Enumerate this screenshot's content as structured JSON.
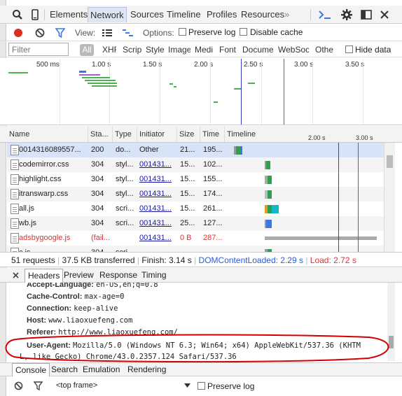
{
  "toolbar": {
    "tabs": [
      "Elements",
      "Network",
      "Sources",
      "Timeline",
      "Profiles",
      "Resources"
    ],
    "active_tab": "Network",
    "more_glyph": "»"
  },
  "controls": {
    "view_label": "View:",
    "options_label": "Options:",
    "preserve_log": "Preserve log",
    "disable_cache": "Disable cache"
  },
  "filter": {
    "placeholder": "Filter",
    "types": [
      "All",
      "XHR",
      "Scripts",
      "Stylesheets",
      "Images",
      "Media",
      "Font",
      "Document",
      "WebSockets",
      "Other"
    ],
    "visible_types": [
      "All",
      "XHF",
      "Scrip",
      "Style",
      "Image",
      "Medi",
      "Font",
      "Docume",
      "WebSoc",
      "Othe"
    ],
    "hide_data": "Hide data"
  },
  "overview": {
    "ticks": [
      "500 ms",
      "1.00 s",
      "1.50 s",
      "2.00 s",
      "2.50 s",
      "3.00 s",
      "3.50 s"
    ]
  },
  "table": {
    "columns": [
      "Name",
      "Sta...",
      "Type",
      "Initiator",
      "Size",
      "Time",
      "Timeline"
    ],
    "timeline_ticks": [
      "2.00 s",
      "3.00 s"
    ],
    "rows": [
      {
        "name": "0014316089557...",
        "status": "200",
        "type": "do...",
        "initiator": "Other",
        "size": "21...",
        "time": "195...",
        "selected": true,
        "error": false
      },
      {
        "name": "codemirror.css",
        "status": "304",
        "type": "styl...",
        "initiator": "001431...",
        "size": "15...",
        "time": "102...",
        "selected": false,
        "error": false
      },
      {
        "name": "highlight.css",
        "status": "304",
        "type": "styl...",
        "initiator": "001431...",
        "size": "15...",
        "time": "155...",
        "selected": false,
        "error": false
      },
      {
        "name": "itranswarp.css",
        "status": "304",
        "type": "styl...",
        "initiator": "001431...",
        "size": "15...",
        "time": "174...",
        "selected": false,
        "error": false
      },
      {
        "name": "all.js",
        "status": "304",
        "type": "scri...",
        "initiator": "001431...",
        "size": "15...",
        "time": "261...",
        "selected": false,
        "error": false
      },
      {
        "name": "wb.js",
        "status": "304",
        "type": "scri...",
        "initiator": "001431...",
        "size": "25...",
        "time": "127...",
        "selected": false,
        "error": false
      },
      {
        "name": "adsbygoogle.js",
        "status": "(fail...",
        "type": "",
        "initiator": "001431...",
        "size": "0 B",
        "time": "287...",
        "selected": false,
        "error": true
      },
      {
        "name": "c.js",
        "status": "304",
        "type": "scri...",
        "initiator": "",
        "size": "",
        "time": "",
        "selected": false,
        "error": false
      }
    ]
  },
  "summary": {
    "requests": "51 requests",
    "transferred": "37.5 KB transferred",
    "finish": "Finish: 3.14 s",
    "dcl": "DOMContentLoaded: 2.29 s",
    "load": "Load: 2.72 s"
  },
  "details": {
    "tabs": [
      "Headers",
      "Preview",
      "Response",
      "Timing"
    ],
    "active_tab": "Headers",
    "headers": [
      {
        "k": "Accept-Language:",
        "v": "en-US,en;q=0.8"
      },
      {
        "k": "Cache-Control:",
        "v": "max-age=0"
      },
      {
        "k": "Connection:",
        "v": "keep-alive"
      },
      {
        "k": "Host:",
        "v": "www.liaoxuefeng.com"
      },
      {
        "k": "Referer:",
        "v": "http://www.liaoxuefeng.com/"
      },
      {
        "k": "User-Agent:",
        "v": "Mozilla/5.0 (Windows NT 6.3; Win64; x64) AppleWebKit/537.36 (KHTM"
      }
    ],
    "ua_continuation": "L, like Gecko) Chrome/43.0.2357.124 Safari/537.36"
  },
  "drawer": {
    "tabs": [
      "Console",
      "Search",
      "Emulation",
      "Rendering"
    ],
    "active_tab": "Console",
    "frame": "<top frame>",
    "preserve_log": "Preserve log"
  },
  "colors": {
    "accent": "#3b78e7",
    "record": "#d93025",
    "dcl_line": "#3a3ad0",
    "load_line": "#d33",
    "annotation": "#d40000"
  }
}
